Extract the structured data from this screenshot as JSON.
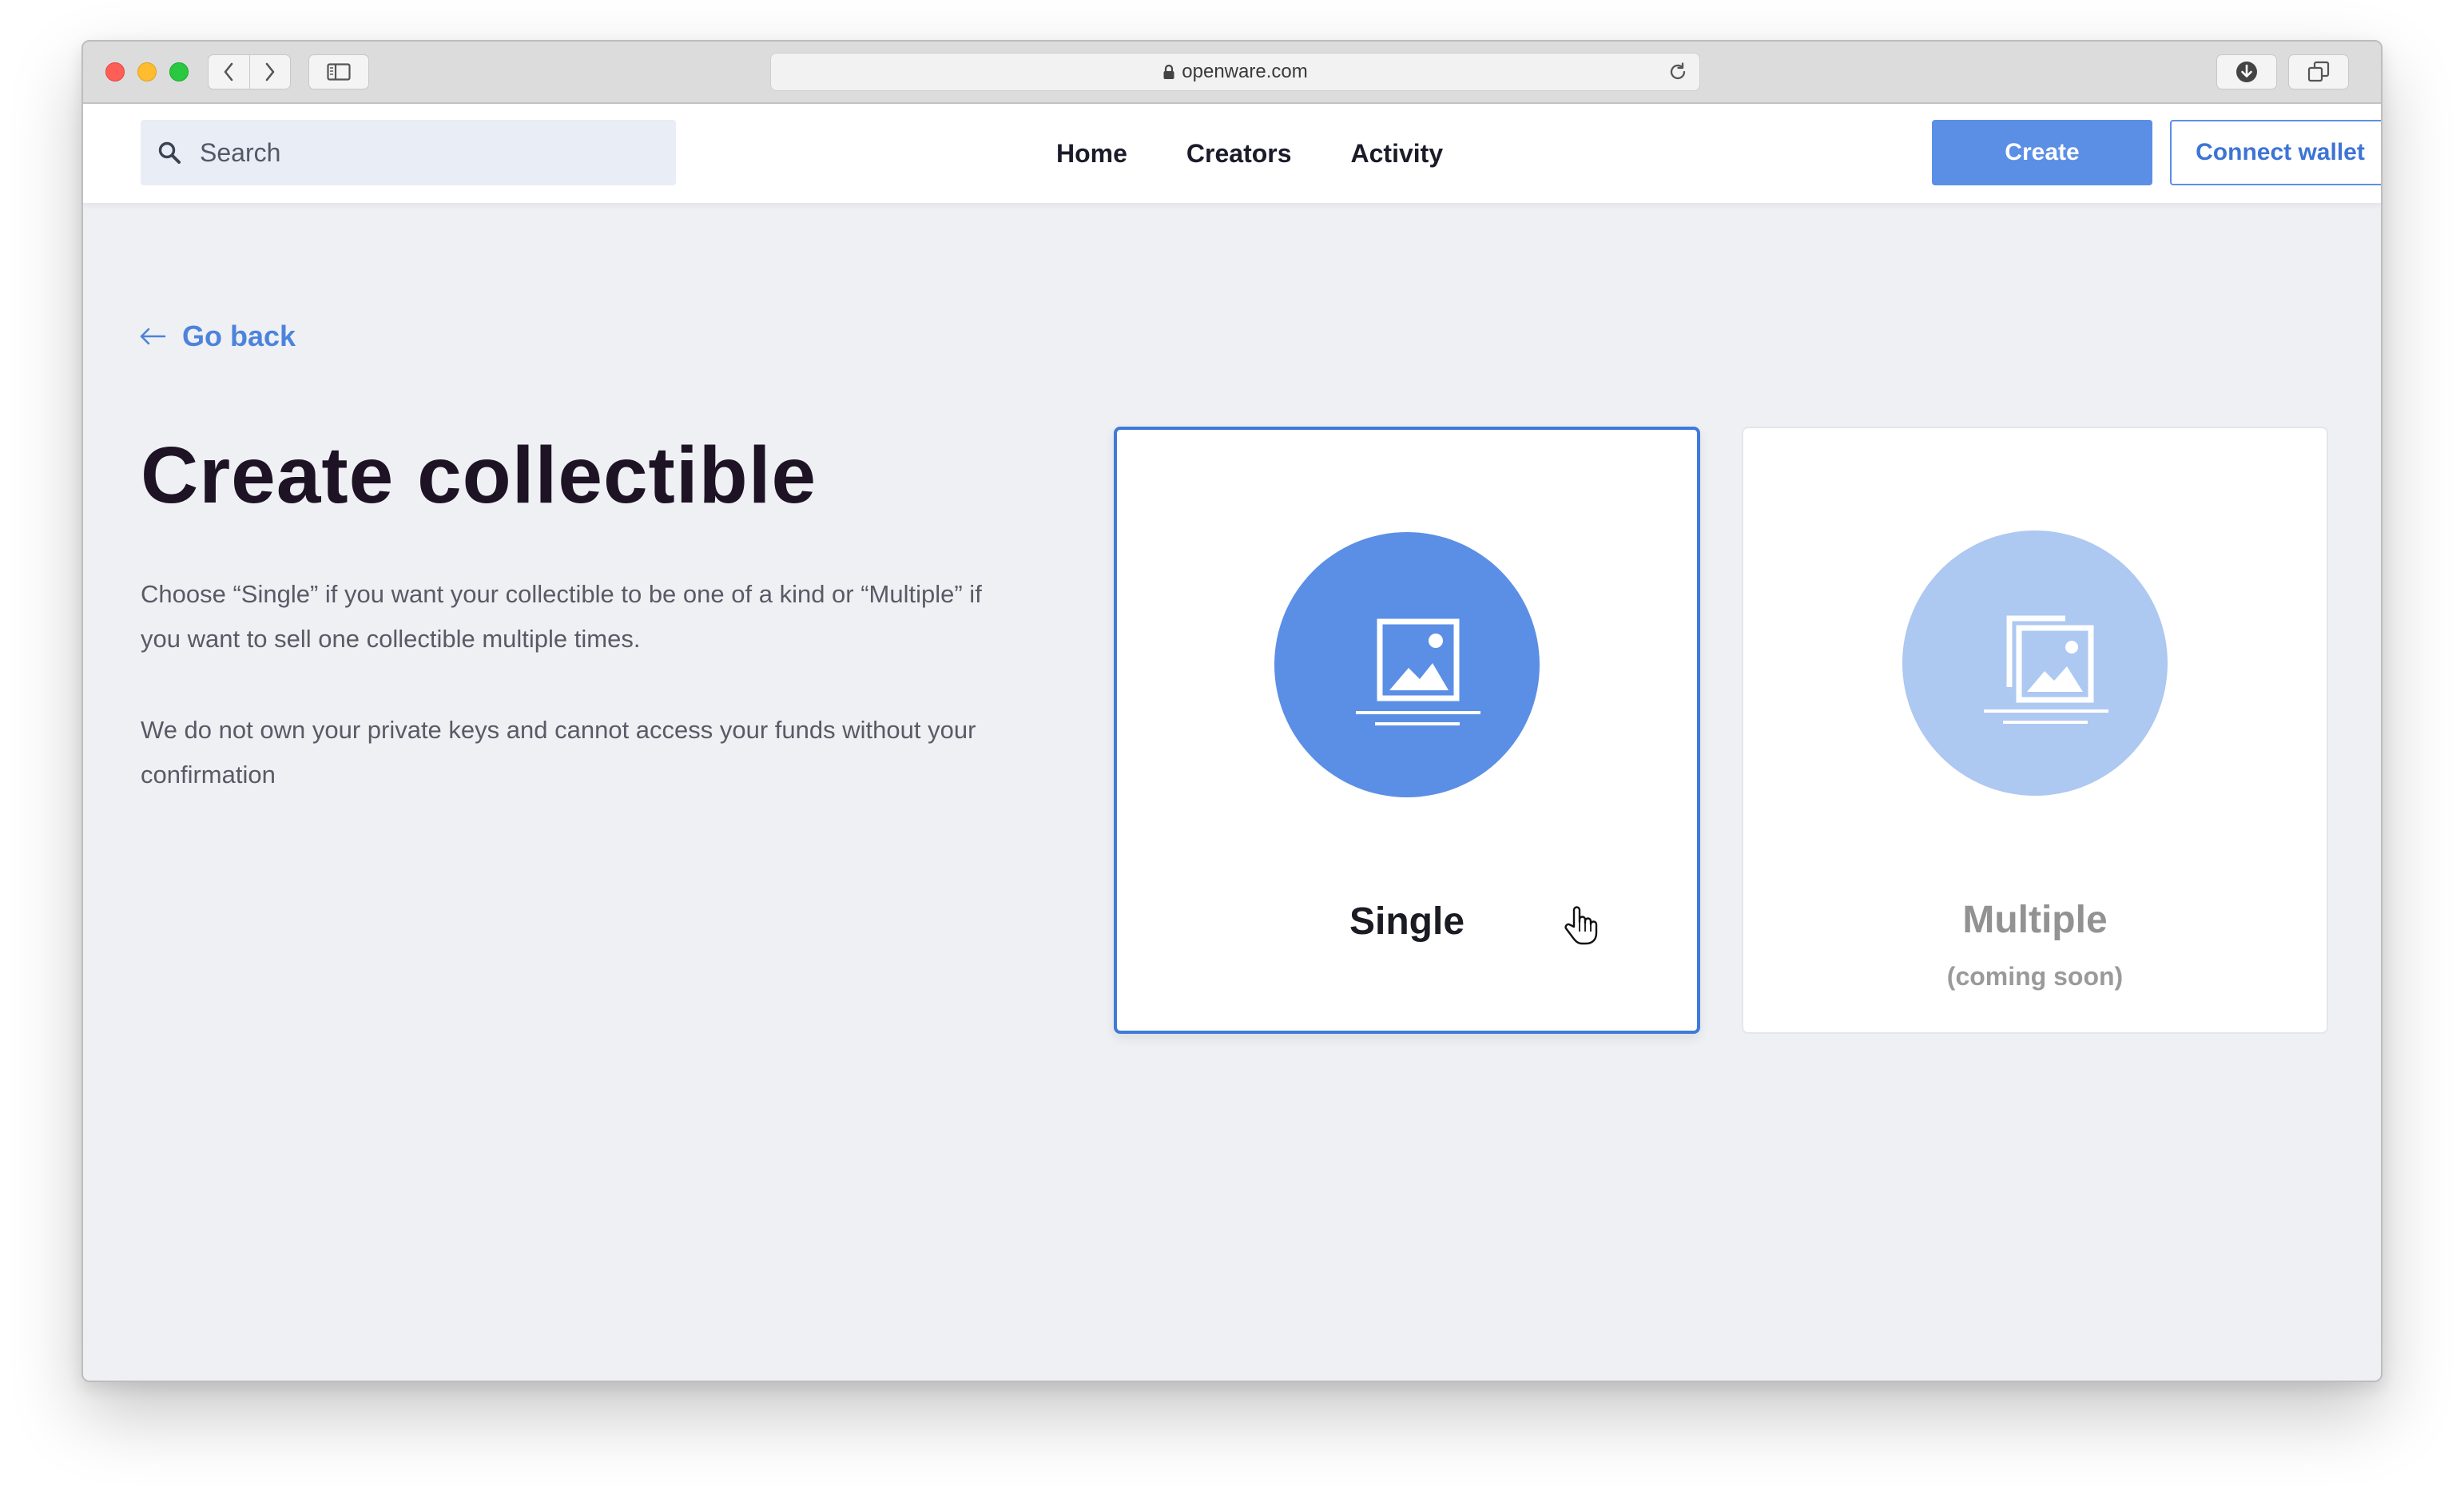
{
  "browser": {
    "url": "openware.com",
    "icons": [
      "back-icon",
      "forward-icon",
      "sidebar-icon",
      "lock-icon",
      "reload-icon",
      "download-icon",
      "tabs-icon"
    ]
  },
  "header": {
    "search_placeholder": "Search",
    "nav": [
      "Home",
      "Creators",
      "Activity"
    ],
    "create_label": "Create",
    "connect_label": "Connect wallet"
  },
  "main": {
    "go_back": "Go back",
    "title": "Create collectible",
    "paragraph1": "Choose “Single” if you want your collectible to be one of a kind or “Multiple” if you want to sell one collectible multiple times.",
    "paragraph2": "We do not own your private keys and cannot access your funds without your confirmation"
  },
  "options": {
    "single": {
      "label": "Single",
      "selected": true
    },
    "multiple": {
      "label": "Multiple",
      "note": "(coming soon)",
      "selected": false
    }
  },
  "colors": {
    "accent": "#5b8fe6",
    "accent_light": "#adc8f1",
    "selected_border": "#3f7ad8",
    "page_bg": "#eff0f4",
    "title_text": "#1d1325"
  }
}
